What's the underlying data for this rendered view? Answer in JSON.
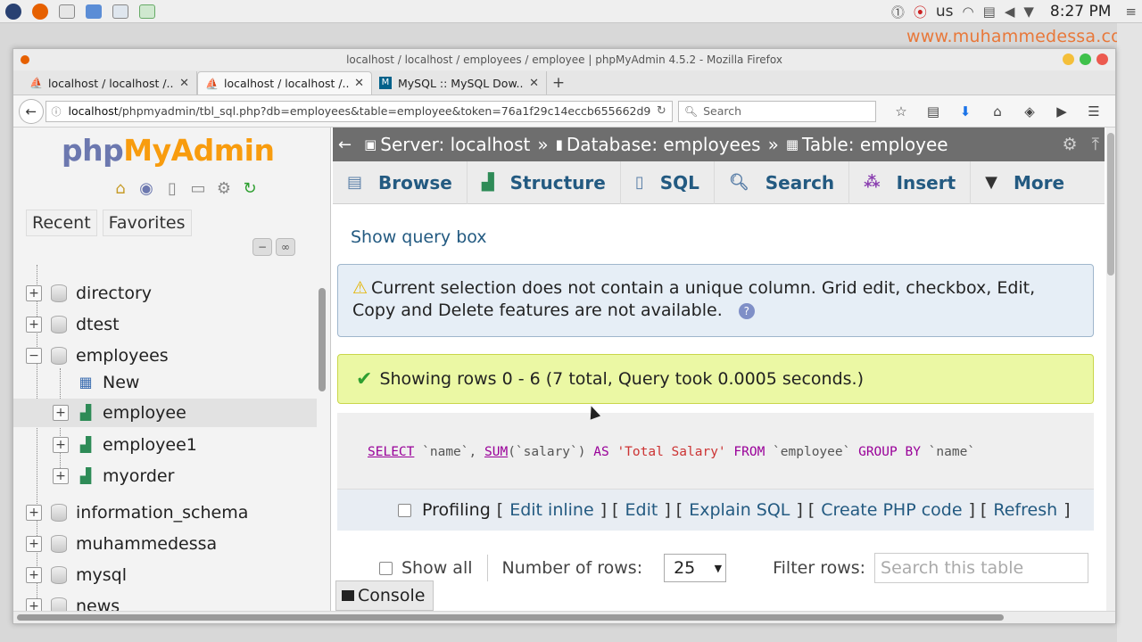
{
  "os": {
    "keyboard_layout": "us",
    "clock": "8:27 PM"
  },
  "watermark": "www.muhammedessa.com",
  "browser": {
    "window_title": "localhost / localhost / employees / employee | phpMyAdmin 4.5.2 - Mozilla Firefox",
    "tabs": [
      {
        "label": "localhost / localhost /...",
        "active": false
      },
      {
        "label": "localhost / localhost /...",
        "active": true
      },
      {
        "label": "MySQL :: MySQL Dow...",
        "active": false
      }
    ],
    "url_host": "localhost",
    "url_path": "/phpmyadmin/tbl_sql.php?db=employees&table=employee&token=76a1f29c14eccb655662d9",
    "search_placeholder": "Search"
  },
  "pma": {
    "logo_part1": "php",
    "logo_part2": "MyAdmin",
    "recent_label": "Recent",
    "favorites_label": "Favorites",
    "tree": {
      "items": [
        {
          "label": "directory"
        },
        {
          "label": "dtest"
        },
        {
          "label": "employees"
        },
        {
          "label": "New"
        },
        {
          "label": "employee"
        },
        {
          "label": "employee1"
        },
        {
          "label": "myorder"
        },
        {
          "label": "information_schema"
        },
        {
          "label": "muhammedessa"
        },
        {
          "label": "mysql"
        },
        {
          "label": "news"
        }
      ]
    },
    "breadcrumb": {
      "server": "Server: localhost",
      "database": "Database: employees",
      "table": "Table: employee",
      "separator": "»"
    },
    "tabs": [
      {
        "label": "Browse",
        "icon": "browse-icon"
      },
      {
        "label": "Structure",
        "icon": "structure-icon"
      },
      {
        "label": "SQL",
        "icon": "sql-icon"
      },
      {
        "label": "Search",
        "icon": "search-icon"
      },
      {
        "label": "Insert",
        "icon": "insert-icon"
      },
      {
        "label": "More",
        "icon": "chevron-down-icon"
      }
    ],
    "show_query_box": "Show query box",
    "notice": "Current selection does not contain a unique column. Grid edit, checkbox, Edit, Copy and Delete features are not available.",
    "success": "Showing rows 0 - 6 (7 total, Query took 0.0005 seconds.)",
    "sql": {
      "select": "SELECT",
      "col1": "`name`",
      "comma": ",",
      "sum": "SUM",
      "col2": "(`salary`)",
      "as": "AS",
      "alias": "'Total Salary'",
      "from": "FROM",
      "table": "`employee`",
      "group_by": "GROUP BY",
      "col3": "`name`"
    },
    "profiling": {
      "label": "Profiling",
      "links": [
        "Edit inline",
        "Edit",
        "Explain SQL",
        "Create PHP code",
        "Refresh"
      ]
    },
    "navigation": {
      "show_all": "Show all",
      "number_of_rows_label": "Number of rows:",
      "number_of_rows_value": "25",
      "filter_label": "Filter rows:",
      "filter_placeholder": "Search this table"
    },
    "console_label": "Console"
  }
}
